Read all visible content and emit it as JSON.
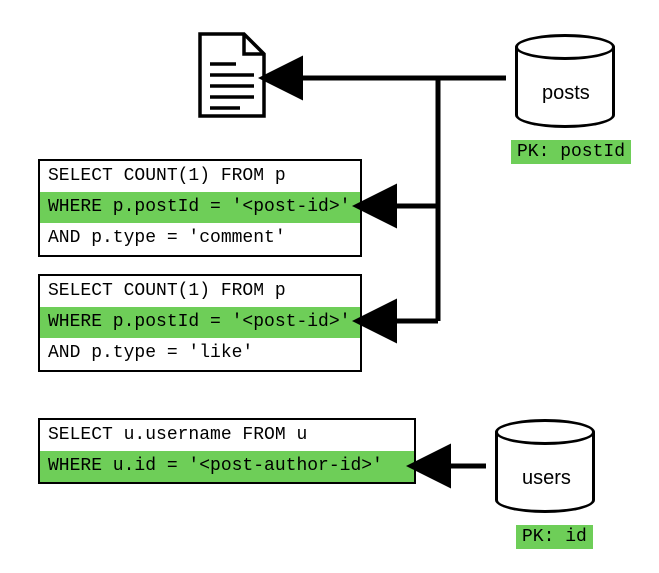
{
  "posts_db": {
    "label": "posts",
    "pk": "PK: postId"
  },
  "users_db": {
    "label": "users",
    "pk": "PK: id"
  },
  "query1": {
    "l1": "SELECT COUNT(1) FROM p",
    "l2": "WHERE p.postId = '<post-id>'",
    "l3": "AND p.type = 'comment'"
  },
  "query2": {
    "l1": "SELECT COUNT(1) FROM p",
    "l2": "WHERE p.postId = '<post-id>'",
    "l3": "AND p.type = 'like'"
  },
  "query3": {
    "l1": "SELECT u.username FROM u",
    "l2": "WHERE u.id = '<post-author-id>'"
  }
}
